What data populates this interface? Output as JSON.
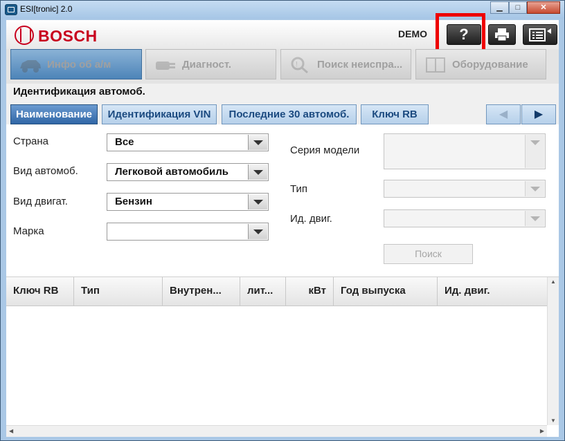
{
  "window": {
    "title": "ESI[tronic] 2.0",
    "controls": {
      "minimize": "▁",
      "maximize": "□",
      "close": "✕"
    }
  },
  "header": {
    "brand": "BOSCH",
    "mode_label": "DEMO",
    "tools": [
      {
        "name": "help-button",
        "icon": "question-icon",
        "glyph": "?"
      },
      {
        "name": "print-button",
        "icon": "printer-icon",
        "glyph": ""
      },
      {
        "name": "menu-button",
        "icon": "menu-list-icon",
        "glyph": ""
      }
    ],
    "highlight_color": "#ee0000"
  },
  "nav": {
    "tabs": [
      {
        "label": "Инфо об а/м",
        "icon": "car-icon"
      },
      {
        "label": "Диагност.",
        "icon": "plug-icon"
      },
      {
        "label": "Поиск неиспра...",
        "icon": "search-warning-icon"
      },
      {
        "label": "Оборудование",
        "icon": "book-icon"
      }
    ]
  },
  "section": {
    "title": "Идентификация автомоб."
  },
  "subtabs": [
    {
      "label": "Наименование",
      "active": true
    },
    {
      "label": "Идентификация VIN",
      "active": false
    },
    {
      "label": "Последние 30 автомоб.",
      "active": false
    },
    {
      "label": "Ключ RB",
      "active": false
    }
  ],
  "form": {
    "country": {
      "label": "Страна",
      "value": "Все"
    },
    "vehicle_type": {
      "label": "Вид автомоб.",
      "value": "Легковой автомобиль"
    },
    "engine_type": {
      "label": "Вид двигат.",
      "value": "Бензин"
    },
    "make": {
      "label": "Марка",
      "value": ""
    },
    "model_series": {
      "label": "Серия модели",
      "value": ""
    },
    "type": {
      "label": "Тип",
      "value": ""
    },
    "engine_id": {
      "label": "Ид. двиг.",
      "value": ""
    },
    "search_label": "Поиск"
  },
  "table": {
    "columns": [
      "Ключ RB",
      "Тип",
      "Внутрен...",
      "лит...",
      "кВт",
      "Год выпуска",
      "Ид. двиг."
    ],
    "rows": []
  },
  "colors": {
    "accent": "#3066a6",
    "brand": "#c8001e"
  }
}
